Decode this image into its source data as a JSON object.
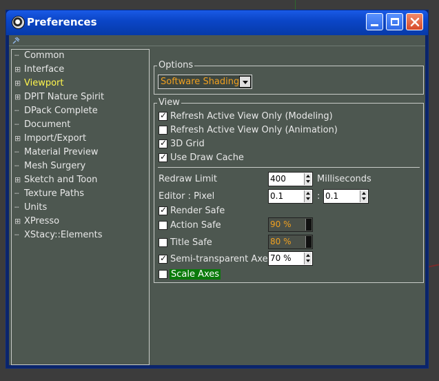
{
  "window": {
    "title": "Preferences"
  },
  "tree": {
    "items": [
      {
        "label": "Common",
        "expandable": false,
        "selected": false
      },
      {
        "label": "Interface",
        "expandable": true,
        "selected": false
      },
      {
        "label": "Viewport",
        "expandable": true,
        "selected": true
      },
      {
        "label": "DPIT Nature Spirit",
        "expandable": true,
        "selected": false
      },
      {
        "label": "DPack Complete",
        "expandable": false,
        "selected": false
      },
      {
        "label": "Document",
        "expandable": false,
        "selected": false
      },
      {
        "label": "Import/Export",
        "expandable": true,
        "selected": false
      },
      {
        "label": "Material Preview",
        "expandable": false,
        "selected": false
      },
      {
        "label": "Mesh Surgery",
        "expandable": false,
        "selected": false
      },
      {
        "label": "Sketch and Toon",
        "expandable": true,
        "selected": false
      },
      {
        "label": "Texture Paths",
        "expandable": false,
        "selected": false
      },
      {
        "label": "Units",
        "expandable": false,
        "selected": false
      },
      {
        "label": "XPresso",
        "expandable": true,
        "selected": false
      },
      {
        "label": "XStacy::Elements",
        "expandable": false,
        "selected": false
      }
    ]
  },
  "options": {
    "group_label": "Options",
    "shading_value": "Software Shading"
  },
  "view": {
    "group_label": "View",
    "refresh_modeling": {
      "label": "Refresh Active View Only (Modeling)",
      "checked": true
    },
    "refresh_animation": {
      "label": "Refresh Active View Only (Animation)",
      "checked": false
    },
    "grid_3d": {
      "label": "3D Grid",
      "checked": true
    },
    "draw_cache": {
      "label": "Use Draw Cache",
      "checked": true
    },
    "redraw_limit": {
      "label": "Redraw Limit",
      "value": "400",
      "unit": "Milliseconds"
    },
    "editor_pixel": {
      "label": "Editor : Pixel",
      "value_x": "0.1",
      "separator": ":",
      "value_y": "0.1"
    },
    "render_safe": {
      "label": "Render Safe",
      "checked": true
    },
    "action_safe": {
      "label": "Action Safe",
      "checked": false,
      "value": "90 %"
    },
    "title_safe": {
      "label": "Title Safe",
      "checked": false,
      "value": "80 %"
    },
    "semi_axes": {
      "label": "Semi-transparent Axes",
      "checked": true,
      "value": "70 %"
    },
    "scale_axes": {
      "label": "Scale Axes",
      "checked": false
    }
  },
  "colors": {
    "selected_tree_item": "#fff54c",
    "disabled_value": "#f0a020",
    "highlight_green": "#0a7a0a"
  }
}
